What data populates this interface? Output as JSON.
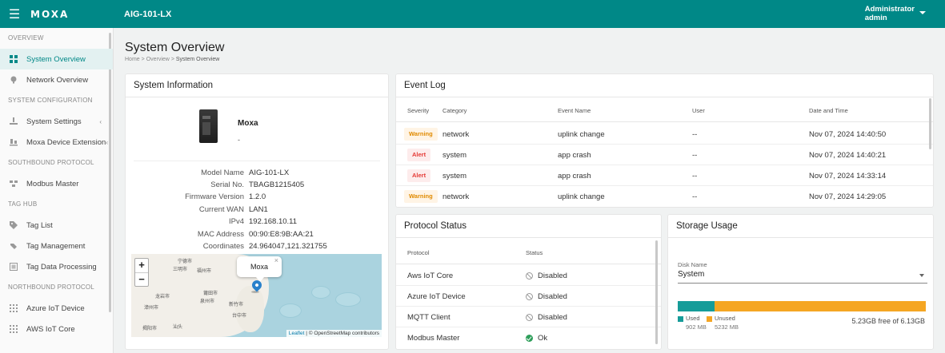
{
  "topbar": {
    "logo": "MOXA",
    "app_title": "AIG-101-LX",
    "user_role": "Administrator",
    "user_name": "admin",
    "accent": "#008887"
  },
  "sidebar": {
    "sections": [
      {
        "title": "OVERVIEW",
        "items": [
          {
            "label": "System Overview",
            "icon": "grid-icon",
            "active": true
          },
          {
            "label": "Network Overview",
            "icon": "globe-icon"
          }
        ]
      },
      {
        "title": "SYSTEM CONFIGURATION",
        "items": [
          {
            "label": "System Settings",
            "icon": "settings-icon",
            "chevron": "‹"
          },
          {
            "label": "Moxa Device Extension",
            "icon": "extension-icon",
            "chevron": "‹"
          }
        ]
      },
      {
        "title": "SOUTHBOUND PROTOCOL",
        "items": [
          {
            "label": "Modbus Master",
            "icon": "modbus-icon"
          }
        ]
      },
      {
        "title": "TAG HUB",
        "items": [
          {
            "label": "Tag List",
            "icon": "tag-list-icon"
          },
          {
            "label": "Tag Management",
            "icon": "tag-management-icon"
          },
          {
            "label": "Tag Data Processing",
            "icon": "data-processing-icon"
          }
        ]
      },
      {
        "title": "NORTHBOUND PROTOCOL",
        "items": [
          {
            "label": "Azure IoT Device",
            "icon": "azure-icon"
          },
          {
            "label": "AWS IoT Core",
            "icon": "aws-icon"
          }
        ]
      }
    ]
  },
  "page": {
    "title": "System Overview",
    "breadcrumb": [
      "Home",
      "Overview",
      "System Overview"
    ],
    "breadcrumb_sep": ">"
  },
  "system_info": {
    "title": "System Information",
    "device_name": "Moxa",
    "device_sub": "-",
    "rows": [
      {
        "label": "Model Name",
        "value": "AIG-101-LX"
      },
      {
        "label": "Serial No.",
        "value": "TBAGB1215405"
      },
      {
        "label": "Firmware Version",
        "value": "1.2.0"
      },
      {
        "label": "Current WAN",
        "value": "LAN1"
      },
      {
        "label": "IPv4",
        "value": "192.168.10.11"
      },
      {
        "label": "MAC Address",
        "value": "00:90:E8:9B:AA:21"
      },
      {
        "label": "Coordinates",
        "value": "24.964047,121.321755"
      }
    ],
    "map": {
      "zoom_in": "+",
      "zoom_out": "−",
      "popup": "Moxa",
      "popup_close": "×",
      "attribution_link": "Leaflet",
      "attribution_rest": " | © OpenStreetMap contributors",
      "labels": [
        "宁德市",
        "福州市",
        "三明市",
        "莆田市",
        "泉州市",
        "新竹市",
        "龙岩市",
        "漳州市",
        "台中市",
        "揭阳市",
        "汕头"
      ]
    }
  },
  "event_log": {
    "title": "Event Log",
    "columns": [
      "Severity",
      "Category",
      "Event Name",
      "User",
      "Date and Time"
    ],
    "rows": [
      {
        "severity": "Warning",
        "category": "network",
        "event": "uplink change",
        "user": "--",
        "time": "Nov 07, 2024 14:40:50"
      },
      {
        "severity": "Alert",
        "category": "system",
        "event": "app crash",
        "user": "--",
        "time": "Nov 07, 2024 14:40:21"
      },
      {
        "severity": "Alert",
        "category": "system",
        "event": "app crash",
        "user": "--",
        "time": "Nov 07, 2024 14:33:14"
      },
      {
        "severity": "Warning",
        "category": "network",
        "event": "uplink change",
        "user": "--",
        "time": "Nov 07, 2024 14:29:05"
      }
    ]
  },
  "protocol_status": {
    "title": "Protocol Status",
    "columns": [
      "Protocol",
      "Status"
    ],
    "rows": [
      {
        "protocol": "Aws IoT Core",
        "status": "Disabled",
        "icon": "disabled-icon"
      },
      {
        "protocol": "Azure IoT Device",
        "status": "Disabled",
        "icon": "disabled-icon"
      },
      {
        "protocol": "MQTT Client",
        "status": "Disabled",
        "icon": "disabled-icon"
      },
      {
        "protocol": "Modbus Master",
        "status": "Ok",
        "icon": "ok-icon"
      }
    ]
  },
  "storage": {
    "title": "Storage Usage",
    "disk_label": "Disk Name",
    "disk_value": "System",
    "used_label": "Used",
    "used_value": "902 MB",
    "unused_label": "Unused",
    "unused_value": "5232 MB",
    "used_fraction": 0.147,
    "free_text": "5.23GB free of 6.13GB",
    "used_color": "#169c99",
    "unused_color": "#f5a623"
  }
}
